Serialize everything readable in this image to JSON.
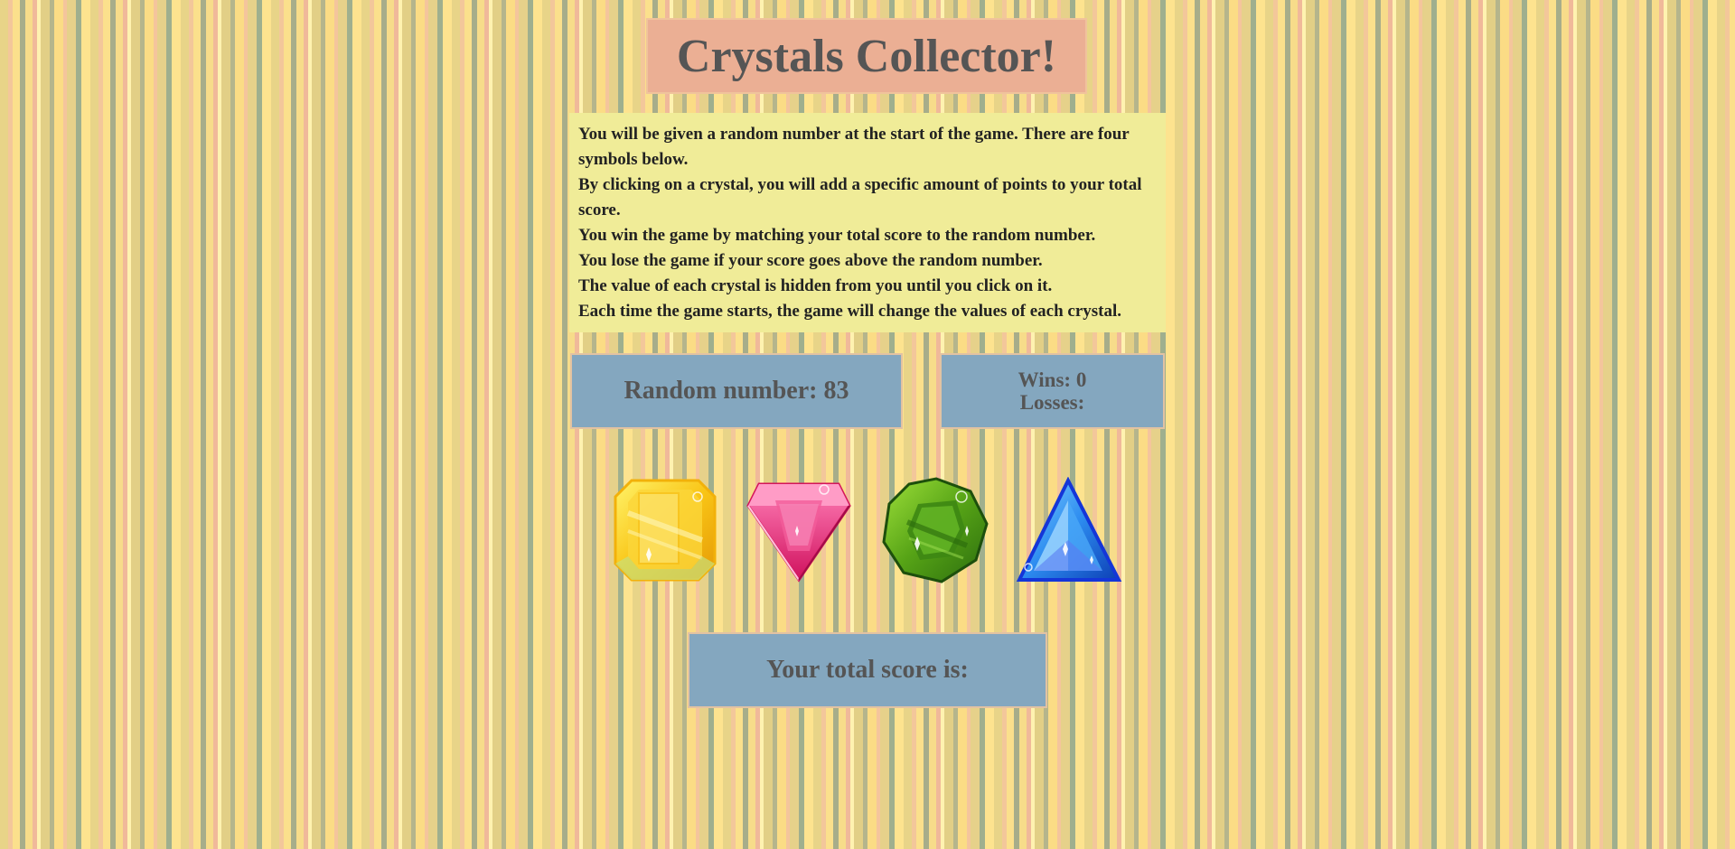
{
  "title": "Crystals Collector!",
  "instructions": [
    "You will be given a random number at the start of the game. There are four symbols below.",
    "By clicking on a crystal, you will add a specific amount of points to your total score.",
    "You win the game by matching your total score to the random number.",
    "You lose the game if your score goes above the random number.",
    "The value of each crystal is hidden from you until you click on it.",
    "Each time the game starts, the game will change the values of each crystal."
  ],
  "random_number": {
    "label": "Random number: ",
    "value": "83"
  },
  "stats": {
    "wins_label": "Wins: ",
    "wins_value": "0",
    "losses_label": "Losses:",
    "losses_value": ""
  },
  "score": {
    "label": "Your total score is:",
    "value": ""
  },
  "crystals": [
    {
      "name": "yellow-crystal",
      "icon": "yellow-octagon-gem-icon",
      "color": "#f7c814"
    },
    {
      "name": "pink-crystal",
      "icon": "pink-diamond-gem-icon",
      "color": "#e8287a"
    },
    {
      "name": "green-crystal",
      "icon": "green-octagon-gem-icon",
      "color": "#5aa416"
    },
    {
      "name": "blue-crystal",
      "icon": "blue-triangle-gem-icon",
      "color": "#1e6fe6"
    }
  ],
  "colors": {
    "title_bg": "#ebaf94",
    "instructions_bg": "#f0ec98",
    "panel_bg": "#84a7bf",
    "text": "#555555"
  }
}
